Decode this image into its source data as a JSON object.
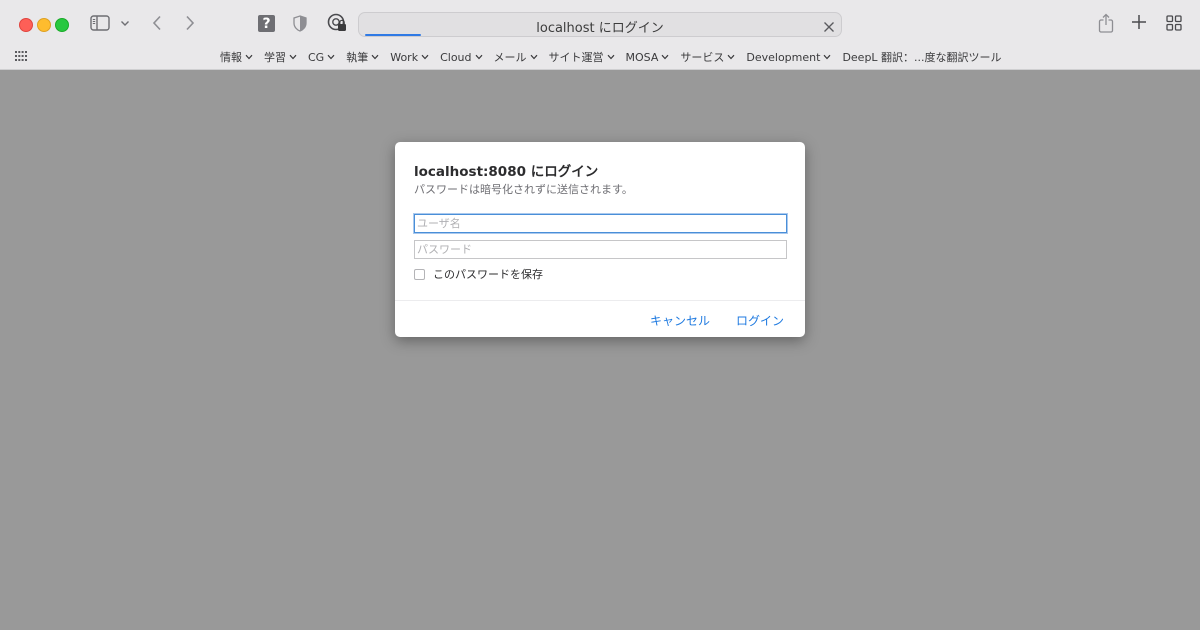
{
  "address_bar": {
    "title": "localhost にログイン",
    "loading_progress_percent": 12
  },
  "bookmarks": [
    {
      "label": "情報"
    },
    {
      "label": "学習"
    },
    {
      "label": "CG"
    },
    {
      "label": "執筆"
    },
    {
      "label": "Work"
    },
    {
      "label": "Cloud"
    },
    {
      "label": "メール"
    },
    {
      "label": "サイト運営"
    },
    {
      "label": "MOSA"
    },
    {
      "label": "サービス"
    },
    {
      "label": "Development"
    },
    {
      "label": "DeepL 翻訳：...度な翻訳ツール"
    }
  ],
  "dialog": {
    "title": "localhost:8080 にログイン",
    "subtitle": "パスワードは暗号化されずに送信されます。",
    "username_placeholder": "ユーザ名",
    "username_value": "",
    "password_placeholder": "パスワード",
    "password_value": "",
    "save_password_label": "このパスワードを保存",
    "save_password_checked": false,
    "cancel_label": "キャンセル",
    "login_label": "ログイン"
  },
  "colors": {
    "page_overlay": "#999999",
    "toolbar": "#e9e8ea",
    "accent": "#1f7ae0",
    "traffic_close": "#fe5f57",
    "traffic_minimize": "#febc2e",
    "traffic_maximize": "#28c840"
  },
  "icons": {
    "sidebar": "sidebar-icon",
    "back": "chevron-left-icon",
    "forward": "chevron-right-icon",
    "help_extension": "question-icon",
    "privacy_extension": "shield-icon",
    "password_extension": "password-manager-icon",
    "share": "share-icon",
    "new_tab": "plus-icon",
    "tab_overview": "grid-icon",
    "favorites": "apps-grid-icon"
  }
}
